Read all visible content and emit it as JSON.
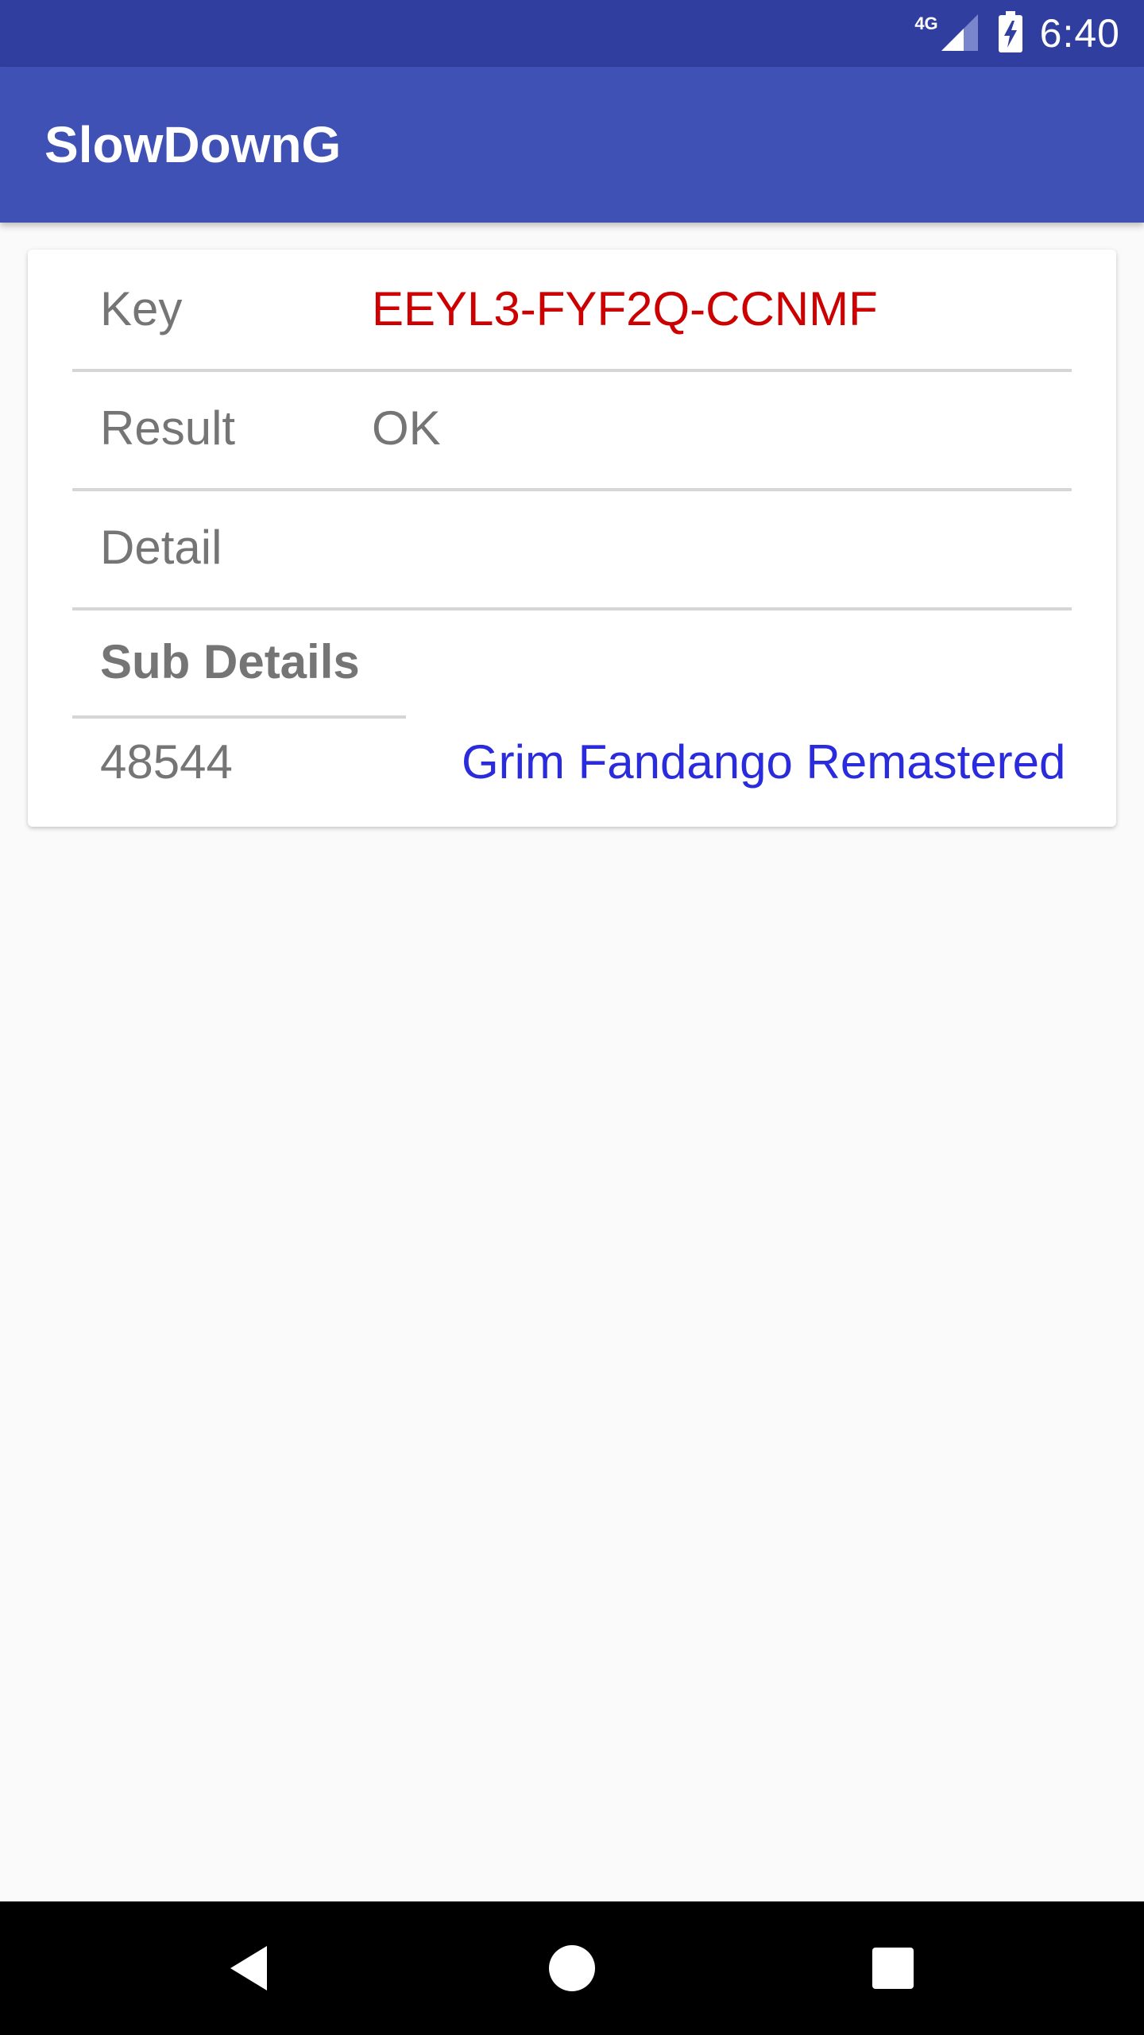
{
  "status_bar": {
    "network": "4G",
    "time": "6:40"
  },
  "app_bar": {
    "title": "SlowDownG"
  },
  "card": {
    "rows": [
      {
        "label": "Key",
        "value": "EEYL3-FYF2Q-CCNMF"
      },
      {
        "label": "Result",
        "value": "OK"
      },
      {
        "label": "Detail",
        "value": ""
      }
    ],
    "sub_details": {
      "heading": "Sub Details",
      "items": [
        {
          "id": "48544",
          "title": "Grim Fandango Remastered"
        }
      ]
    }
  },
  "colors": {
    "status_bar": "#303f9f",
    "app_bar": "#3f51b5",
    "key_value": "#cc0000",
    "link": "#2b2bde",
    "label_text": "#757575"
  },
  "nav_bar": {
    "icons": [
      "back-icon",
      "home-icon",
      "recents-icon"
    ]
  }
}
